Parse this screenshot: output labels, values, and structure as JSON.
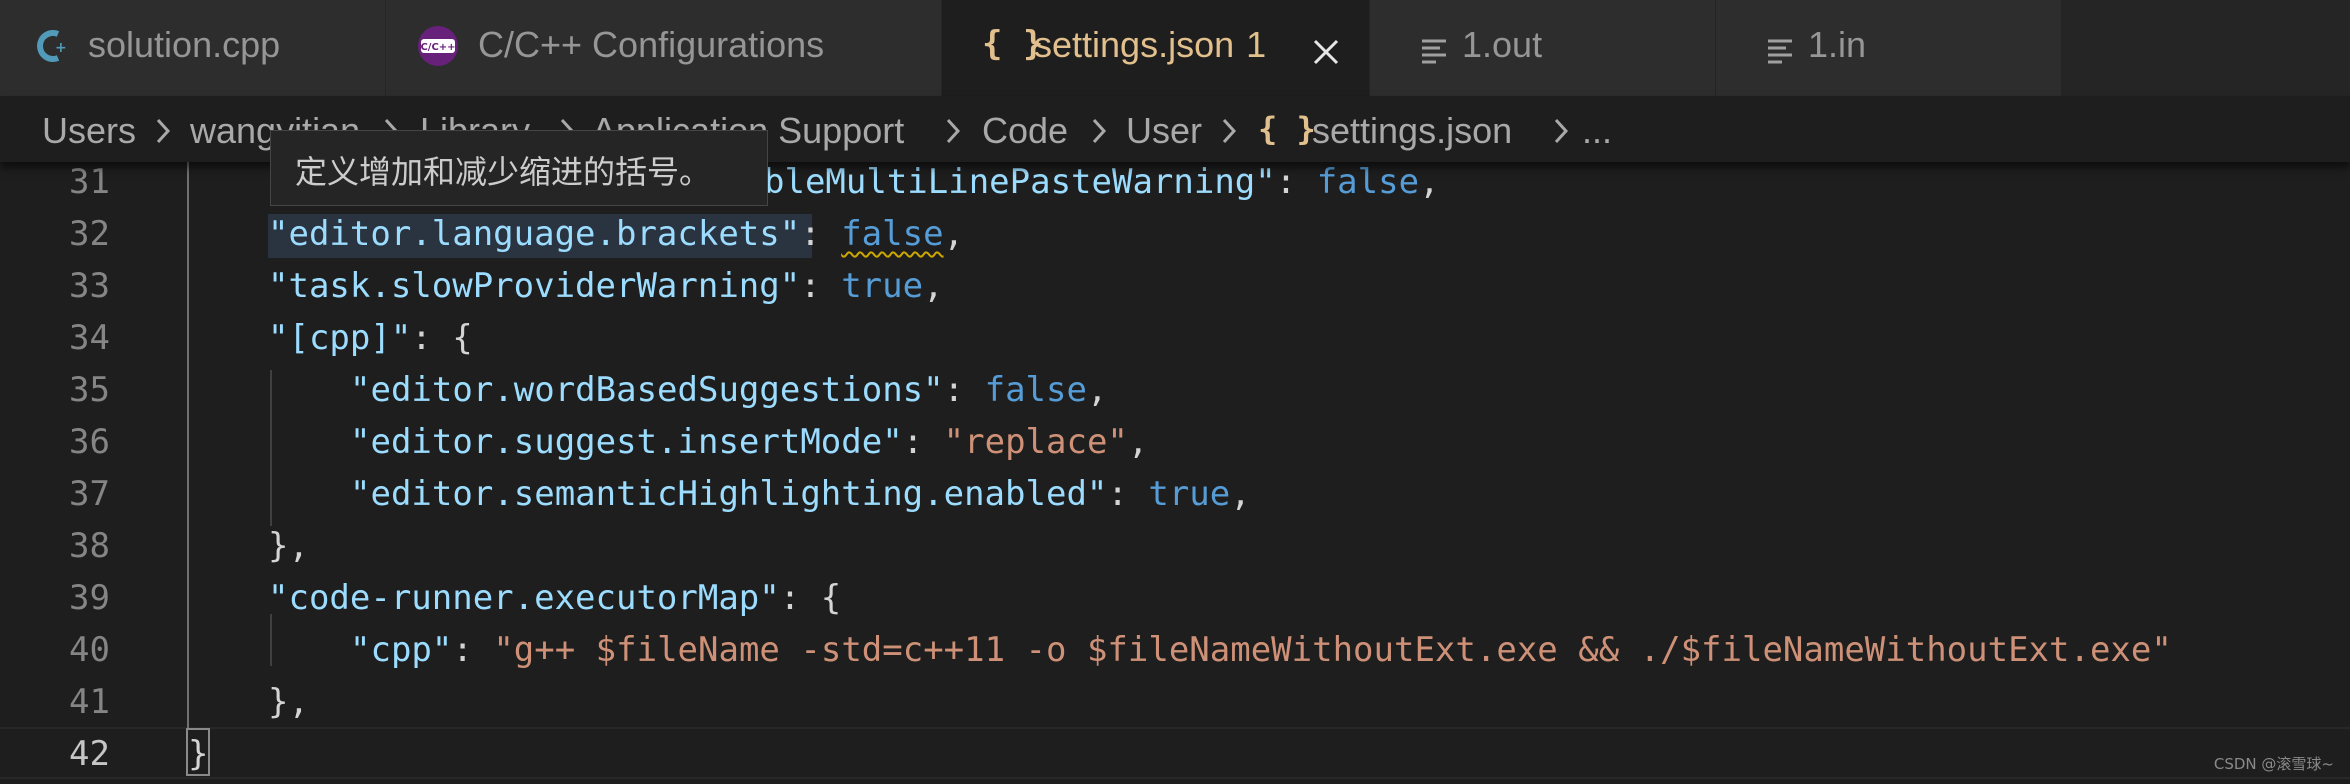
{
  "tabs": [
    {
      "label": "solution.cpp",
      "icon": "cpp-icon",
      "active": false
    },
    {
      "label": "C/C++ Configurations",
      "icon": "cpp-extension-icon",
      "icon_text": "C/C++",
      "active": false
    },
    {
      "label": "settings.json",
      "icon": "json-braces-icon",
      "icon_text": "{ }",
      "badge": "1",
      "active": true,
      "close": "close-icon"
    },
    {
      "label": "1.out",
      "icon": "text-file-icon",
      "active": false
    },
    {
      "label": "1.in",
      "icon": "text-file-icon",
      "active": false
    }
  ],
  "breadcrumb": {
    "items": [
      "Users",
      "wangyitian",
      "Library",
      "Application Support",
      "Code",
      "User",
      "settings.json",
      "..."
    ],
    "file_icon_text": "{ }"
  },
  "tooltip": {
    "text": "定义增加和减少缩进的括号。"
  },
  "editor": {
    "lines": [
      {
        "num": "31",
        "code_key": "\"editor.disableMultiLinePasteWarning\"",
        "visible_key": "bleMultiLinePasteWarning\"",
        "value": "false"
      },
      {
        "num": "32",
        "key": "\"editor.language.brackets\"",
        "colon": ":",
        "value": "false",
        "comma": ","
      },
      {
        "num": "33",
        "key": "\"task.slowProviderWarning\"",
        "colon": ":",
        "value": "true",
        "comma": ","
      },
      {
        "num": "34",
        "key": "\"[cpp]\"",
        "colon": ":",
        "open": "{"
      },
      {
        "num": "35",
        "key": "\"editor.wordBasedSuggestions\"",
        "colon": ":",
        "value": "false",
        "comma": ","
      },
      {
        "num": "36",
        "key": "\"editor.suggest.insertMode\"",
        "colon": ":",
        "value": "\"replace\"",
        "comma": ","
      },
      {
        "num": "37",
        "key": "\"editor.semanticHighlighting.enabled\"",
        "colon": ":",
        "value": "true",
        "comma": ","
      },
      {
        "num": "38",
        "close": "},"
      },
      {
        "num": "39",
        "key": "\"code-runner.executorMap\"",
        "colon": ":",
        "open": "{"
      },
      {
        "num": "40",
        "key": "\"cpp\"",
        "colon": ":",
        "value": "\"g++ $fileName -std=c++11 -o $fileNameWithoutExt.exe && ./$fileNameWithoutExt.exe\""
      },
      {
        "num": "41",
        "close": "},"
      },
      {
        "num": "42",
        "close": "}"
      }
    ]
  },
  "watermark": "CSDN @滚雪球~",
  "colors": {
    "key": "#9cdcfe",
    "string": "#ce9178",
    "boolean": "#569cd6",
    "active_tab_text": "#e2c08d",
    "warning": "#cca700"
  }
}
